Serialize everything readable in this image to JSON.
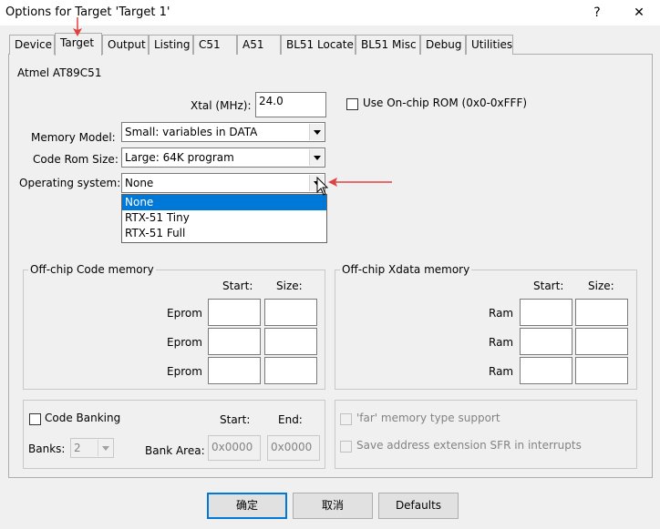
{
  "window": {
    "title": "Options for Target 'Target 1'",
    "help_glyph": "?",
    "close_glyph": "✕"
  },
  "tabs": [
    {
      "label": "Device"
    },
    {
      "label": "Target"
    },
    {
      "label": "Output"
    },
    {
      "label": "Listing"
    },
    {
      "label": "C51"
    },
    {
      "label": "A51"
    },
    {
      "label": "BL51 Locate"
    },
    {
      "label": "BL51 Misc"
    },
    {
      "label": "Debug"
    },
    {
      "label": "Utilities"
    }
  ],
  "active_tab": "Target",
  "device_name": "Atmel AT89C51",
  "xtal": {
    "label": "Xtal (MHz):",
    "value": "24.0"
  },
  "use_onchip_rom": {
    "label": "Use On-chip ROM (0x0-0xFFF)",
    "checked": false
  },
  "memory_model": {
    "label": "Memory Model:",
    "value": "Small: variables in DATA"
  },
  "code_rom_size": {
    "label": "Code Rom Size:",
    "value": "Large: 64K program"
  },
  "operating_system": {
    "label": "Operating system:",
    "value": "None",
    "options": [
      "None",
      "RTX-51 Tiny",
      "RTX-51 Full"
    ],
    "selected": "None"
  },
  "offchip_code": {
    "title": "Off-chip Code memory",
    "start_header": "Start:",
    "size_header": "Size:",
    "rows": [
      {
        "label": "Eprom",
        "start": "",
        "size": ""
      },
      {
        "label": "Eprom",
        "start": "",
        "size": ""
      },
      {
        "label": "Eprom",
        "start": "",
        "size": ""
      }
    ]
  },
  "offchip_xdata": {
    "title": "Off-chip Xdata memory",
    "start_header": "Start:",
    "size_header": "Size:",
    "rows": [
      {
        "label": "Ram",
        "start": "",
        "size": ""
      },
      {
        "label": "Ram",
        "start": "",
        "size": ""
      },
      {
        "label": "Ram",
        "start": "",
        "size": ""
      }
    ]
  },
  "code_banking": {
    "label": "Code Banking",
    "checked": false,
    "banks_label": "Banks:",
    "banks_value": "2",
    "start_header": "Start:",
    "end_header": "End:",
    "bank_area_label": "Bank Area:",
    "bank_area_start": "0x0000",
    "bank_area_end": "0x0000"
  },
  "far_memory": {
    "label": "'far' memory type support",
    "checked": false,
    "enabled": false
  },
  "save_sfr": {
    "label": "Save address extension SFR in interrupts",
    "checked": false,
    "enabled": false
  },
  "buttons": {
    "ok": "确定",
    "cancel": "取消",
    "defaults": "Defaults"
  },
  "colors": {
    "accent": "#0078d7",
    "annotation_arrow": "#e04040",
    "background": "#f0f0f0"
  }
}
